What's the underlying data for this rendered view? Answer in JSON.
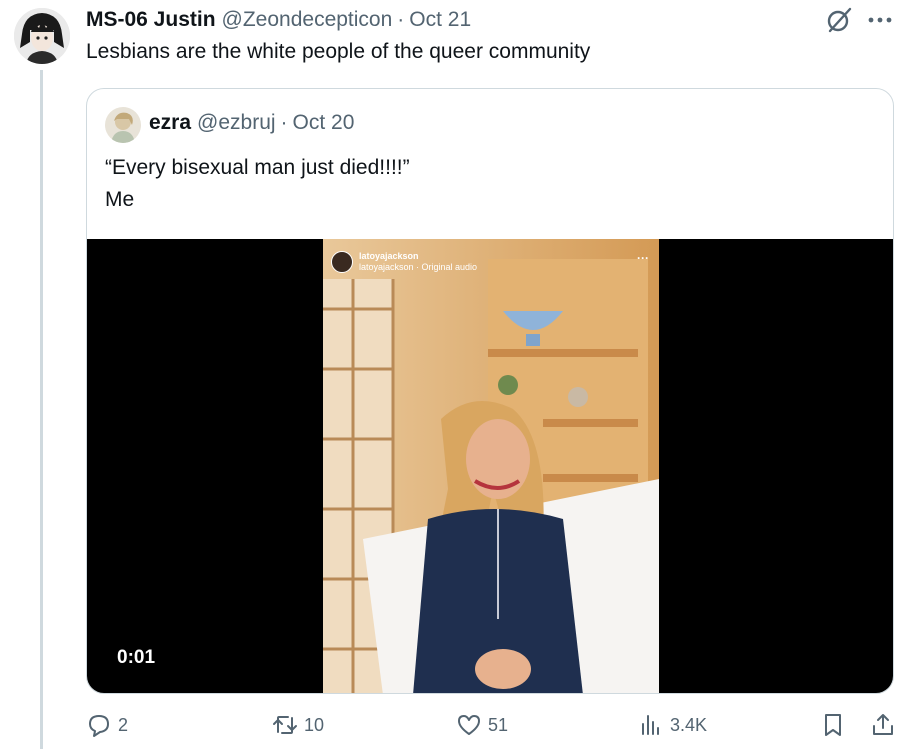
{
  "tweet": {
    "author_name": "MS-06 Justin",
    "author_handle": "@Zeondecepticon",
    "separator": "·",
    "date": "Oct 21",
    "text": "Lesbians are the white people of the queer community"
  },
  "quote": {
    "author_name": "ezra",
    "author_handle": "@ezbruj",
    "separator": "·",
    "date": "Oct 20",
    "text": "“Every bisexual man just died!!!!”\nMe",
    "video": {
      "timestamp": "0:01",
      "overlay_username": "latoyajackson",
      "overlay_audio": "latoyajackson · Original audio",
      "overlay_more": "···"
    }
  },
  "actions": {
    "replies": "2",
    "reposts": "10",
    "likes": "51",
    "views": "3.4K"
  },
  "icons": [
    "grok-icon",
    "more-icon",
    "reply-icon",
    "retweet-icon",
    "like-icon",
    "views-icon",
    "bookmark-icon",
    "share-icon",
    "verified-icon",
    "music-note-icon"
  ],
  "colors": {
    "text": "#0f1419",
    "secondary": "#536471",
    "border": "#cfd9de",
    "video_bg": "#000000"
  }
}
